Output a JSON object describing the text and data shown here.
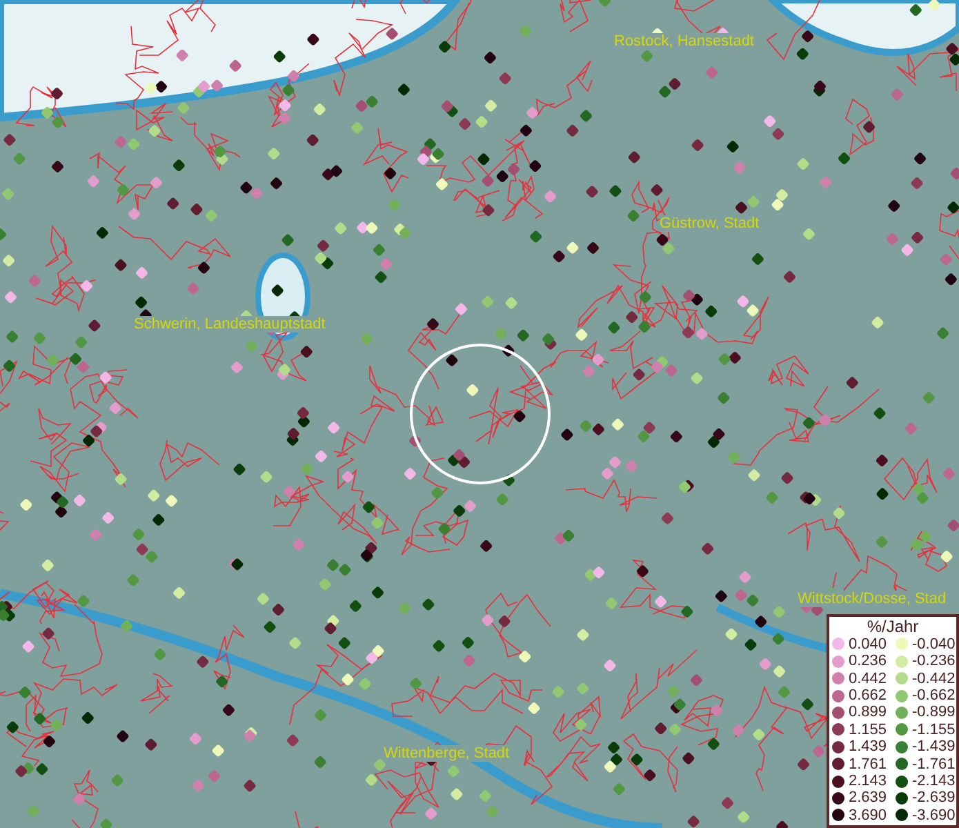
{
  "map": {
    "places": [
      {
        "name": "Rostock, Hansestadt",
        "kind": "city"
      },
      {
        "name": "Güstrow, Stadt",
        "kind": "city"
      },
      {
        "name": "Schwerin, Landeshauptstadt",
        "kind": "city"
      },
      {
        "name": "Wittenberge, Stadt",
        "kind": "city"
      },
      {
        "name": "Wittstock/Dosse, Stad",
        "kind": "city"
      }
    ]
  },
  "legend": {
    "title": "%/Jahr",
    "positive": [
      {
        "label": "0.040",
        "color": "#f4b8e8"
      },
      {
        "label": "0.236",
        "color": "#e49ccc"
      },
      {
        "label": "0.442",
        "color": "#d080ac"
      },
      {
        "label": "0.662",
        "color": "#bc6690"
      },
      {
        "label": "0.899",
        "color": "#a44e72"
      },
      {
        "label": "1.155",
        "color": "#8c3a56"
      },
      {
        "label": "1.439",
        "color": "#762a42"
      },
      {
        "label": "1.761",
        "color": "#601c30"
      },
      {
        "label": "2.143",
        "color": "#4a1020"
      },
      {
        "label": "2.639",
        "color": "#360818"
      },
      {
        "label": "3.690",
        "color": "#220410"
      }
    ],
    "negative": [
      {
        "label": "-0.040",
        "color": "#eef8b8"
      },
      {
        "label": "-0.236",
        "color": "#d2eca2"
      },
      {
        "label": "-0.442",
        "color": "#b2dc8a"
      },
      {
        "label": "-0.662",
        "color": "#92c872"
      },
      {
        "label": "-0.899",
        "color": "#72b05a"
      },
      {
        "label": "-1.155",
        "color": "#529842"
      },
      {
        "label": "-1.439",
        "color": "#3a8032"
      },
      {
        "label": "-1.761",
        "color": "#226822"
      },
      {
        "label": "-2.143",
        "color": "#125012"
      },
      {
        "label": "-2.639",
        "color": "#0a3c0a"
      },
      {
        "label": "-3.690",
        "color": "#042804"
      }
    ]
  }
}
